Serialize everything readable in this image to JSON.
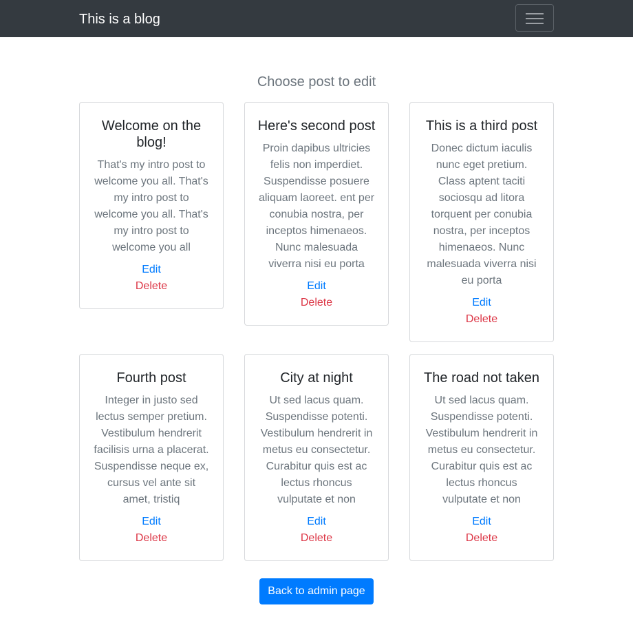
{
  "navbar": {
    "brand": "This is a blog",
    "toggler_icon": "hamburger-menu-icon"
  },
  "page": {
    "heading": "Choose post to edit"
  },
  "posts": [
    {
      "title": "Welcome on the blog!",
      "excerpt": "That's my intro post to welcome you all. That's my intro post to welcome you all. That's my intro post to welcome you all",
      "edit_label": "Edit",
      "delete_label": "Delete"
    },
    {
      "title": "Here's second post",
      "excerpt": "Proin dapibus ultricies felis non imperdiet. Suspendisse posuere aliquam laoreet. ent per conubia nostra, per inceptos himenaeos. Nunc malesuada viverra nisi eu porta",
      "edit_label": "Edit",
      "delete_label": "Delete"
    },
    {
      "title": "This is a third post",
      "excerpt": "Donec dictum iaculis nunc eget pretium. Class aptent taciti sociosqu ad litora torquent per conubia nostra, per inceptos himenaeos. Nunc malesuada viverra nisi eu porta",
      "edit_label": "Edit",
      "delete_label": "Delete"
    },
    {
      "title": "Fourth post",
      "excerpt": "Integer in justo sed lectus semper pretium. Vestibulum hendrerit facilisis urna a placerat. Suspendisse neque ex, cursus vel ante sit amet, tristiq",
      "edit_label": "Edit",
      "delete_label": "Delete"
    },
    {
      "title": "City at night",
      "excerpt": "Ut sed lacus quam. Suspendisse potenti. Vestibulum hendrerit in metus eu consectetur. Curabitur quis est ac lectus rhoncus vulputate et non",
      "edit_label": "Edit",
      "delete_label": "Delete"
    },
    {
      "title": "The road not taken",
      "excerpt": "Ut sed lacus quam. Suspendisse potenti. Vestibulum hendrerit in metus eu consectetur. Curabitur quis est ac lectus rhoncus vulputate et non",
      "edit_label": "Edit",
      "delete_label": "Delete"
    }
  ],
  "footer": {
    "back_label": "Back to admin page"
  },
  "colors": {
    "navbar": "#343a40",
    "primary": "#007bff",
    "danger": "#dc3545",
    "muted": "#6c757d"
  }
}
